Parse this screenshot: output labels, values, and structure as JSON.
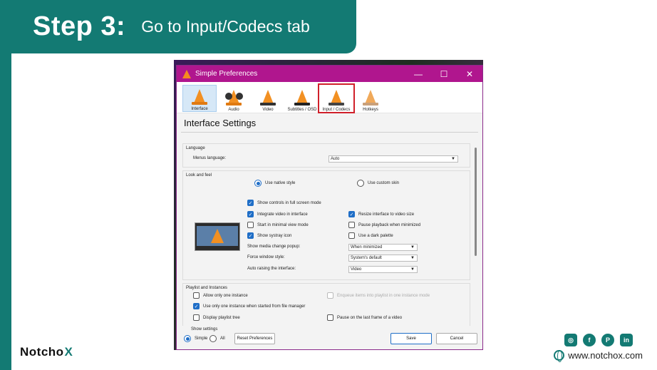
{
  "banner": {
    "step": "Step 3:",
    "instruction": "Go to Input/Codecs tab"
  },
  "window": {
    "title": "Simple Preferences",
    "controls": {
      "minimize": "—",
      "maximize": "☐",
      "close": "✕"
    },
    "tabs": [
      {
        "label": "Interface"
      },
      {
        "label": "Audio"
      },
      {
        "label": "Video"
      },
      {
        "label": "Subtitles / OSD"
      },
      {
        "label": "Input / Codecs"
      },
      {
        "label": "Hotkeys"
      }
    ],
    "heading": "Interface Settings",
    "language": {
      "group": "Language",
      "menus_label": "Menus language:",
      "menus_value": "Auto"
    },
    "look": {
      "group": "Look and feel",
      "native_style": "Use native style",
      "custom_skin": "Use custom skin",
      "show_controls": "Show controls in full screen mode",
      "integrate_video": "Integrate video in interface",
      "resize_interface": "Resize interface to video size",
      "minimal_view": "Start in minimal view mode",
      "pause_minimized": "Pause playback when minimized",
      "systray": "Show systray icon",
      "dark_palette": "Use a dark palette",
      "media_popup_label": "Show media change popup:",
      "media_popup_value": "When minimized",
      "force_style_label": "Force window style:",
      "force_style_value": "System's default",
      "auto_raise_label": "Auto raising the interface:",
      "auto_raise_value": "Video"
    },
    "playlist": {
      "group": "Playlist and Instances",
      "one_instance": "Allow only one instance",
      "enqueue": "Enqueue items into playlist in one instance mode",
      "file_manager": "Use only one instance when started from file manager",
      "playlist_tree": "Display playlist tree",
      "pause_last": "Pause on the last frame of a video"
    },
    "footer": {
      "show_settings": "Show settings",
      "simple": "Simple",
      "all": "All",
      "reset": "Reset Preferences",
      "save": "Save",
      "cancel": "Cancel"
    }
  },
  "brand": {
    "name": "Notcho",
    "x": "X"
  },
  "social": {
    "instagram": "◎",
    "facebook": "f",
    "pinterest": "P",
    "linkedin": "in"
  },
  "website": "www.notchox.com"
}
